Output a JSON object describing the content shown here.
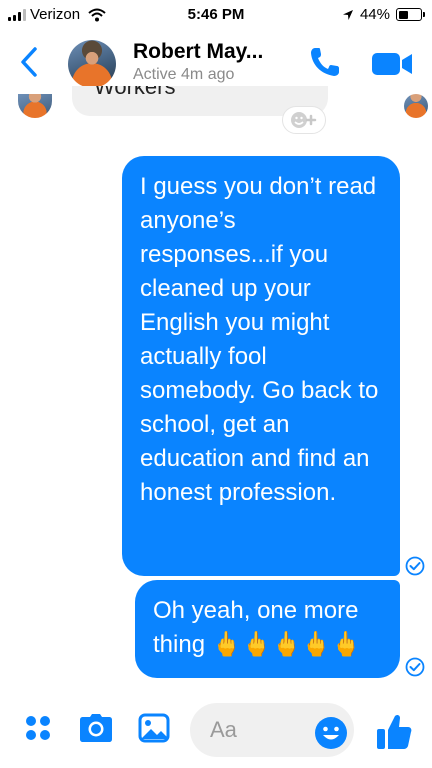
{
  "status_bar": {
    "carrier": "Verizon",
    "time": "5:46 PM",
    "battery": "44%",
    "battery_level": 0.44,
    "icons": [
      "signal-icon",
      "wifi-icon",
      "location-arrow-icon",
      "battery-icon"
    ]
  },
  "header": {
    "contact_name": "Robert May...",
    "status": "Active 4m ago",
    "icons": [
      "back-chevron-icon",
      "phone-icon",
      "video-camera-icon"
    ]
  },
  "messages": {
    "partial_received": "Workers",
    "sent": [
      {
        "text": "I guess you don’t read anyone’s responses...if you cleaned up your English you might actually fool somebody. Go back to school, get an education and find an honest profession."
      },
      {
        "text": "Oh yeah, one more thing 🖕🖕🖕🖕🖕"
      }
    ]
  },
  "composer": {
    "placeholder": "Aa",
    "icons": [
      "apps-grid-icon",
      "camera-icon",
      "photo-icon",
      "emoji-icon",
      "thumbs-up-icon"
    ]
  },
  "colors": {
    "accent": "#0a84ff",
    "received_bubble": "#f0f0f0",
    "secondary_text": "#8a8a8a"
  }
}
